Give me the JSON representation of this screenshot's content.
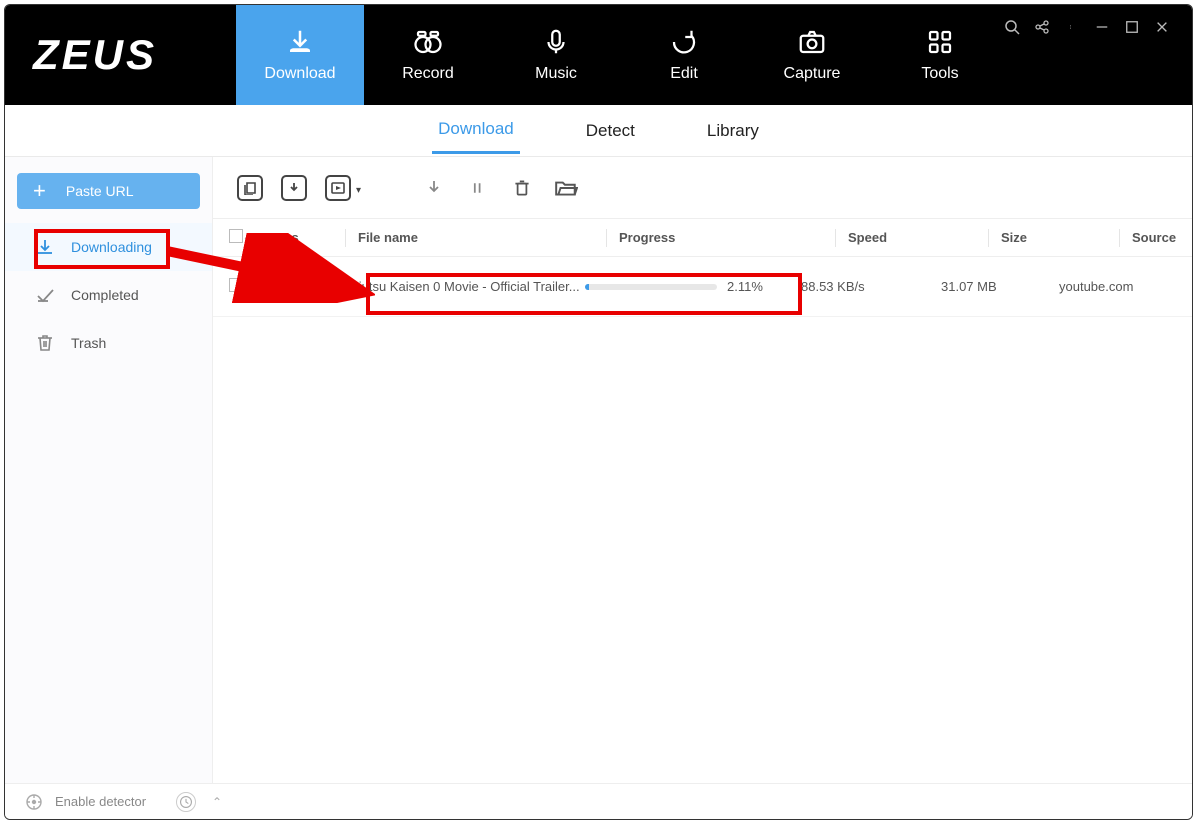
{
  "logo": "ZEUS",
  "top_nav": [
    {
      "label": "Download",
      "icon": "download",
      "active": true
    },
    {
      "label": "Record",
      "icon": "record",
      "active": false
    },
    {
      "label": "Music",
      "icon": "music",
      "active": false
    },
    {
      "label": "Edit",
      "icon": "edit",
      "active": false
    },
    {
      "label": "Capture",
      "icon": "capture",
      "active": false
    },
    {
      "label": "Tools",
      "icon": "tools",
      "active": false
    }
  ],
  "sub_nav": [
    {
      "label": "Download",
      "active": true
    },
    {
      "label": "Detect",
      "active": false
    },
    {
      "label": "Library",
      "active": false
    }
  ],
  "paste_btn": "Paste URL",
  "sidebar": [
    {
      "label": "Downloading",
      "icon": "downloading",
      "active": true
    },
    {
      "label": "Completed",
      "icon": "completed",
      "active": false
    },
    {
      "label": "Trash",
      "icon": "trash",
      "active": false
    }
  ],
  "columns": {
    "status": "Status",
    "filename": "File name",
    "progress": "Progress",
    "speed": "Speed",
    "size": "Size",
    "source": "Source"
  },
  "rows": [
    {
      "filename": "Jujutsu Kaisen 0 Movie - Official Trailer...",
      "progress_pct": "2.11%",
      "progress_val": 2.11,
      "speed": "88.53 KB/s",
      "size": "31.07 MB",
      "source": "youtube.com"
    }
  ],
  "status_bar": {
    "detector": "Enable detector"
  }
}
